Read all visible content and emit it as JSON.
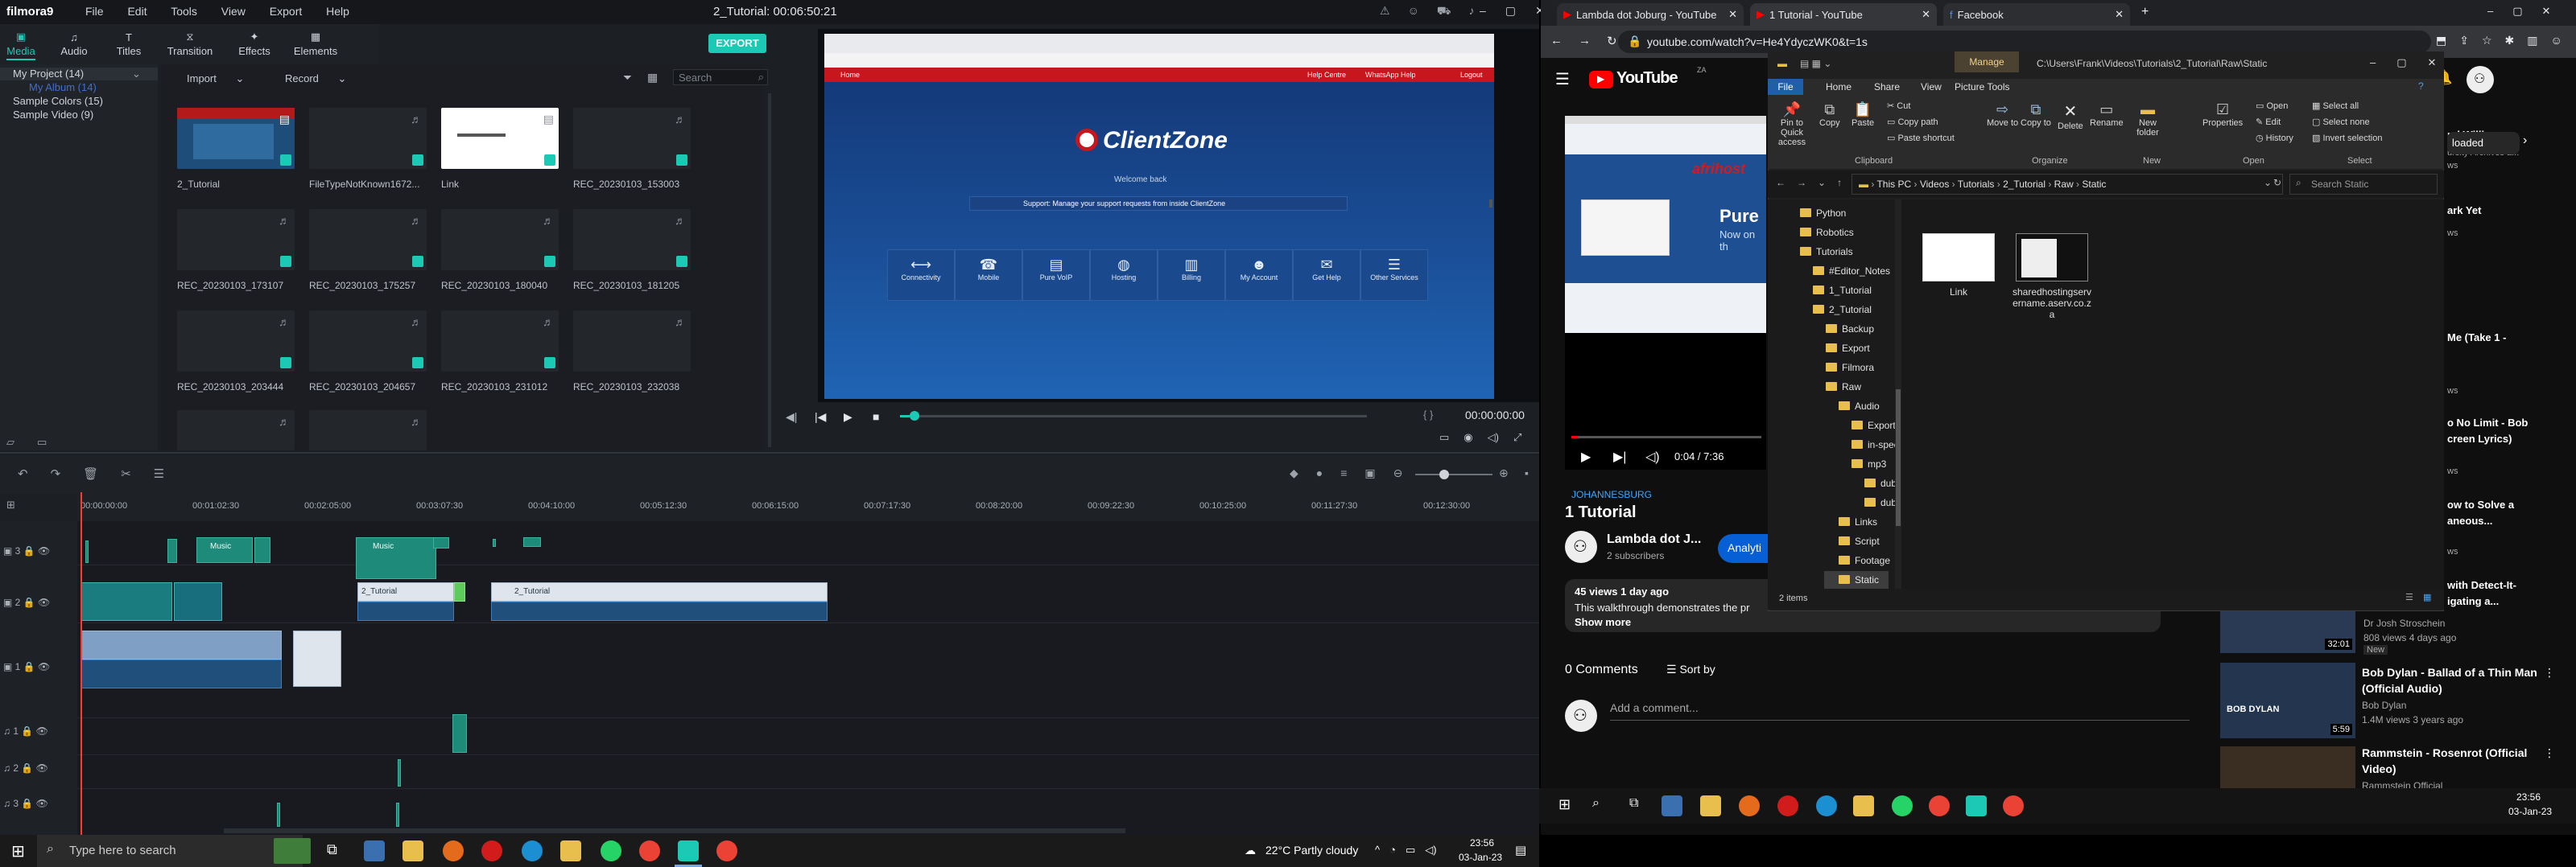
{
  "filmora": {
    "app_name": "filmora9",
    "menu": [
      "File",
      "Edit",
      "Tools",
      "View",
      "Export",
      "Help"
    ],
    "title": "2_Tutorial:  00:06:50:21",
    "tabs": [
      "Media",
      "Audio",
      "Titles",
      "Transition",
      "Effects",
      "Elements"
    ],
    "export_label": "EXPORT",
    "tree": {
      "project": "My Project (14)",
      "album": "My Album (14)",
      "colors": "Sample Colors (15)",
      "video": "Sample Video (9)"
    },
    "toolbar": {
      "import": "Import",
      "record": "Record",
      "search_placeholder": "Search"
    },
    "media_items": [
      "2_Tutorial",
      "FileTypeNotKnown1672...",
      "Link",
      "REC_20230103_153003",
      "REC_20230103_173107",
      "REC_20230103_175257",
      "REC_20230103_180040",
      "REC_20230103_181205",
      "REC_20230103_203444",
      "REC_20230103_204657",
      "REC_20230103_231012",
      "REC_20230103_232038"
    ],
    "player": {
      "site_title": "ClientZone",
      "site_nav": [
        "Home",
        "Help Centre",
        "WhatsApp Help",
        "Logout"
      ],
      "welcome": "Welcome back",
      "support": "Support: Manage your support requests from inside ClientZone",
      "services": [
        "Connectivity",
        "Mobile",
        "Pure VoIP",
        "Hosting",
        "Billing",
        "My Account",
        "Get Help",
        "Other Services"
      ],
      "timecode": "00:00:00:00",
      "progress": 0.02
    },
    "ruler": [
      "00:00:00:00",
      "00:01:02:30",
      "00:02:05:00",
      "00:03:07:30",
      "00:04:10:00",
      "00:05:12:30",
      "00:06:15:00",
      "00:07:17:30",
      "00:08:20:00",
      "00:09:22:30",
      "00:10:25:00",
      "00:11:27:30",
      "00:12:30:00"
    ],
    "tracks": [
      "3",
      "2",
      "1",
      "1",
      "2",
      "3"
    ],
    "clip_labels": {
      "music1": "Music",
      "music2": "Music",
      "tut1": "2_Tutorial",
      "tut2": "2_Tutorial"
    }
  },
  "browser": {
    "tabs": [
      "Lambda dot Joburg - YouTube",
      "1 Tutorial - YouTube",
      "Facebook"
    ],
    "url": "youtube.com/watch?v=He4YdyczWK0&t=1s",
    "youtube": {
      "logo": "YouTube",
      "region": "ZA",
      "video_time": "0:04 / 7:36",
      "channel_tag": "JOHANNESBURG",
      "title": "1 Tutorial",
      "channel": "Lambda dot J...",
      "subscribers": "2 subscribers",
      "analytics_btn": "Analyti",
      "views": "45 views  1 day ago",
      "desc": "This walkthrough demonstrates the pr",
      "show_more": "Show more",
      "comments": "0 Comments",
      "sort": "Sort by",
      "add_comment": "Add a comment...",
      "chip": "loaded",
      "preview_overlay": "afrihost",
      "preview_text_1": "Pure",
      "preview_text_2": "Now on th",
      "recs": [
        {
          "title": "Bob Dylan - Ballad of a Thin Man (Official Audio)",
          "channel": "Bob Dylan",
          "meta": "1.4M views  3 years ago",
          "duration": "5:59"
        },
        {
          "title": "Rammstein - Rosenrot (Official Video)",
          "channel": "Rammstein Official",
          "meta": "",
          "duration": ""
        }
      ],
      "rec_above": {
        "channel": "Dr Josh Stroschein",
        "meta": "808 views  4 days ago",
        "badge": "New",
        "duration": "32:01"
      },
      "side_snippets": [
        "nd Willie",
        "ursity Archives a...",
        "ws",
        "ark Yet",
        "ws",
        "Me (Take 1 -",
        "ws",
        "o No Limit - Bob",
        "creen Lyrics)",
        "ws",
        "ow to Solve a",
        "aneous...",
        "ws",
        "with Detect-It-",
        "igating a..."
      ]
    }
  },
  "explorer": {
    "manage": "Manage",
    "path_title": "C:\\Users\\Frank\\Videos\\Tutorials\\2_Tutorial\\Raw\\Static",
    "ribbon_tabs": [
      "File",
      "Home",
      "Share",
      "View",
      "Picture Tools"
    ],
    "clipboard": [
      "Pin to Quick access",
      "Copy",
      "Paste",
      "Cut",
      "Copy path",
      "Paste shortcut"
    ],
    "organize": [
      "Move to",
      "Copy to",
      "Delete",
      "Rename"
    ],
    "new": [
      "New folder"
    ],
    "open": [
      "Properties",
      "Open",
      "Edit",
      "History"
    ],
    "select": [
      "Select all",
      "Select none",
      "Invert selection"
    ],
    "groups": [
      "Clipboard",
      "Organize",
      "New",
      "Open",
      "Select"
    ],
    "breadcrumb": [
      "This PC",
      "Videos",
      "Tutorials",
      "2_Tutorial",
      "Raw",
      "Static"
    ],
    "search_placeholder": "Search Static",
    "nav": [
      "Python",
      "Robotics",
      "Tutorials",
      "#Editor_Notes",
      "1_Tutorial",
      "2_Tutorial",
      "Backup",
      "Export",
      "Filmora",
      "Raw",
      "Audio",
      "Exports",
      "in-speech",
      "mp3",
      "dub1",
      "dub2",
      "Links",
      "Script",
      "Footage",
      "Static"
    ],
    "files": [
      "Link",
      "sharedhostingservername.aserv.co.za"
    ],
    "status": "2 items"
  },
  "taskbar_left": {
    "search_placeholder": "Type here to search",
    "weather": "22°C  Partly cloudy",
    "time": "23:56",
    "date": "03-Jan-23"
  },
  "taskbar_right": {
    "time": "23:56",
    "date": "03-Jan-23"
  }
}
